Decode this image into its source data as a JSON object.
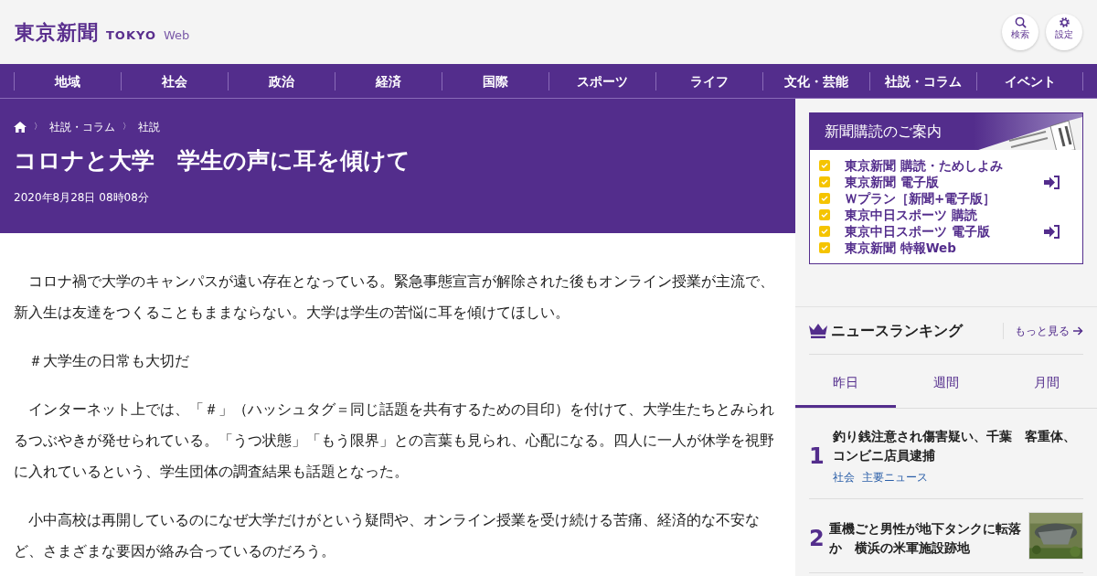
{
  "header": {
    "logo_kanji": "東京新聞",
    "logo_en": "TOKYO",
    "logo_web": "Web",
    "buttons": [
      {
        "kind": "search",
        "label": "検索"
      },
      {
        "kind": "settings",
        "label": "設定"
      }
    ]
  },
  "nav": [
    "地域",
    "社会",
    "政治",
    "経済",
    "国際",
    "スポーツ",
    "ライフ",
    "文化・芸能",
    "社説・コラム",
    "イベント"
  ],
  "breadcrumb": [
    "社説・コラム",
    "社説"
  ],
  "breadcrumb_separator": "〉",
  "article": {
    "title": "コロナと大学　学生の声に耳を傾けて",
    "date": "2020年8月28日 08時08分",
    "paragraphs": [
      "コロナ禍で大学のキャンパスが遠い存在となっている。緊急事態宣言が解除された後もオンライン授業が主流で、新入生は友達をつくることもままならない。大学は学生の苦悩に耳を傾けてほしい。",
      "＃大学生の日常も大切だ",
      "インターネット上では、「＃」（ハッシュタグ＝同じ話題を共有するための目印）を付けて、大学生たちとみられるつぶやきが発せられている。「うつ状態」「もう限界」との言葉も見られ、心配になる。四人に一人が休学を視野に入れているという、学生団体の調査結果も話題となった。",
      "小中高校は再開しているのになぜ大学だけがという疑問や、オンライン授業を受け続ける苦痛、経済的な不安など、さまざまな要因が絡み合っているのだろう。"
    ]
  },
  "subscription": {
    "title": "新聞購読のご案内",
    "items": [
      {
        "label": "東京新聞 購読・ためしよみ",
        "login": false
      },
      {
        "label": "東京新聞 電子版",
        "login": true
      },
      {
        "label": "Ｗプラン［新聞+電子版］",
        "login": false
      },
      {
        "label": "東京中日スポーツ 購読",
        "login": false
      },
      {
        "label": "東京中日スポーツ 電子版",
        "login": true
      },
      {
        "label": "東京新聞 特報Web",
        "login": false
      }
    ]
  },
  "ranking": {
    "title": "ニュースランキング",
    "more": "もっと見る",
    "tabs": [
      {
        "label": "昨日",
        "selected": true
      },
      {
        "label": "週間",
        "selected": false
      },
      {
        "label": "月間",
        "selected": false
      }
    ],
    "items": [
      {
        "rank": "1",
        "title": "釣り銭注意され傷害疑い、千葉　客重体、コンビニ店員逮捕",
        "tags": [
          "社会",
          "主要ニュース"
        ],
        "thumbnail": false
      },
      {
        "rank": "2",
        "title": "重機ごと男性が地下タンクに転落か　横浜の米軍施設跡地",
        "thumbnail": true
      }
    ]
  }
}
